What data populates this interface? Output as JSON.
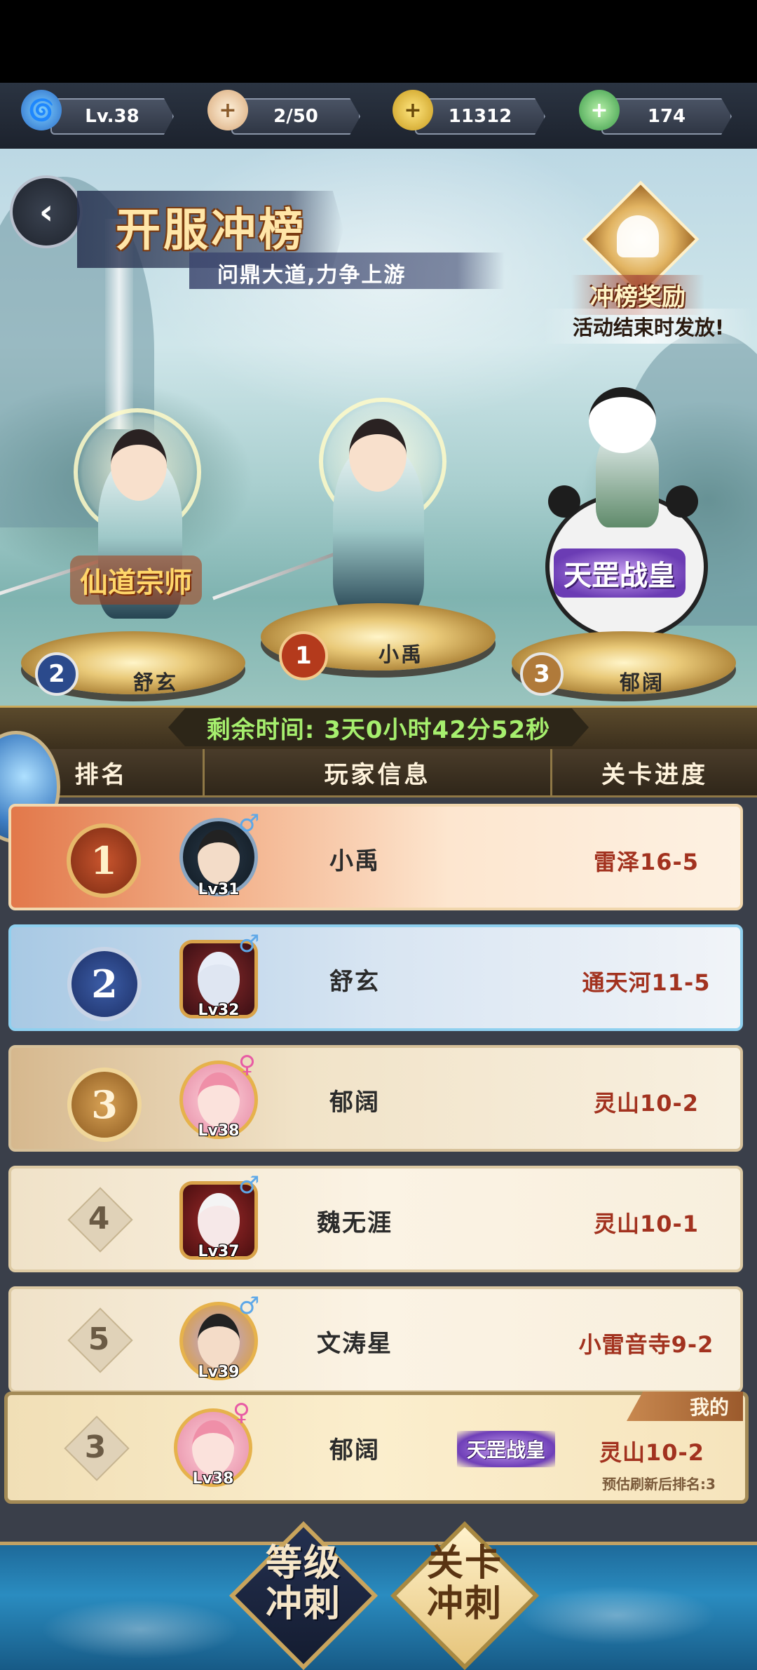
{
  "resources": {
    "level": "Lv.38",
    "stamina": "2/50",
    "coins": "11312",
    "jade": "174"
  },
  "banner": {
    "title": "开服冲榜",
    "subtitle": "问鼎大道,力争上游",
    "reward_title": "冲榜奖励",
    "reward_note": "活动结束时发放!"
  },
  "podium": [
    {
      "rank": "2",
      "name": "舒玄",
      "title": "仙道宗师"
    },
    {
      "rank": "1",
      "name": "小禹"
    },
    {
      "rank": "3",
      "name": "郁阔",
      "title": "天罡战皇"
    }
  ],
  "timer": "剩余时间: 3天0小时42分52秒",
  "table": {
    "headers": [
      "排名",
      "玩家信息",
      "关卡进度"
    ],
    "rows": [
      {
        "rank": "1",
        "name": "小禹",
        "level": "Lv31",
        "gender": "♂",
        "progress": "雷泽16-5"
      },
      {
        "rank": "2",
        "name": "舒玄",
        "level": "Lv32",
        "gender": "♂",
        "progress": "通天河11-5"
      },
      {
        "rank": "3",
        "name": "郁阔",
        "level": "Lv38",
        "gender": "♀",
        "progress": "灵山10-2"
      },
      {
        "rank": "4",
        "name": "魏无涯",
        "level": "Lv37",
        "gender": "♂",
        "progress": "灵山10-1"
      },
      {
        "rank": "5",
        "name": "文涛星",
        "level": "Lv39",
        "gender": "♂",
        "progress": "小雷音寺9-2"
      }
    ],
    "mine": {
      "tag": "我的",
      "rank": "3",
      "name": "郁阔",
      "level": "Lv38",
      "gender": "♀",
      "title": "天罡战皇",
      "progress": "灵山10-2",
      "estimate": "预估刷新后排名:3"
    }
  },
  "nav": {
    "level_sprint": "等级\n冲刺",
    "stage_sprint": "关卡\n冲刺"
  },
  "colors": {
    "timer_text": "#a6ef6e",
    "progress_text": "#a2321f",
    "gold_row": "#e2784a",
    "silver_row": "#a8c9e4"
  }
}
